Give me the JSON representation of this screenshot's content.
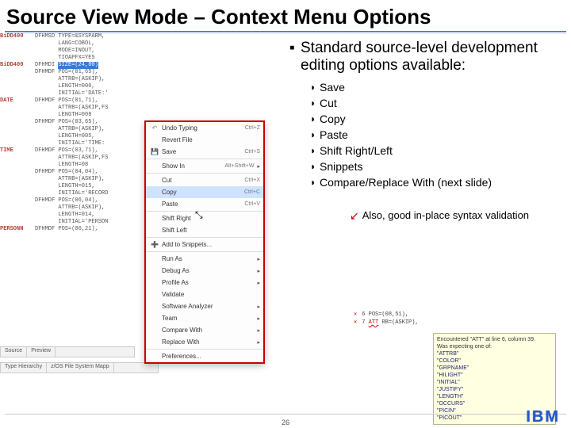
{
  "slide": {
    "title": "Source View Mode – Context Menu Options",
    "page_number": "26",
    "logo_text": "IBM"
  },
  "bullets": {
    "heading": "Standard source-level development  editing options available:",
    "items": [
      "Save",
      "Cut",
      "Copy",
      "Paste",
      "Shift Right/Left",
      "Snippets",
      "Compare/Replace With (next slide)"
    ],
    "note": "Also, good in-place syntax validation"
  },
  "source": {
    "rows": [
      {
        "margin": "BiDD400",
        "code": "DFHMSD TYPE=&SYSPARM,"
      },
      {
        "margin": "",
        "code": "       LANG=COBOL,"
      },
      {
        "margin": "",
        "code": "       MODE=INOUT,"
      },
      {
        "margin": "",
        "code": "       TIOAPFX=YES"
      },
      {
        "margin": "BiDD400",
        "code": "DFHMDI ",
        "hl": "SIZE=(24,80)"
      },
      {
        "margin": "",
        "code": "DFHMDF POS=(01,65),"
      },
      {
        "margin": "",
        "code": "       ATTRB=(ASKIP),"
      },
      {
        "margin": "",
        "code": "       LENGTH=000,"
      },
      {
        "margin": "",
        "code": "       INITIAL='DATE:'"
      },
      {
        "margin": "DATE",
        "code": "DFHMDF POS=(01,71),"
      },
      {
        "margin": "",
        "code": "       ATTRB=(ASKIP,FS"
      },
      {
        "margin": "",
        "code": "       LENGTH=008"
      },
      {
        "margin": "",
        "code": "DFHMDF POS=(03,65),"
      },
      {
        "margin": "",
        "code": "       ATTRB=(ASKIP),"
      },
      {
        "margin": "",
        "code": "       LENGTH=005,"
      },
      {
        "margin": "",
        "code": "       INITIAL='TIME:"
      },
      {
        "margin": "TIME",
        "code": "DFHMDF POS=(03,71),"
      },
      {
        "margin": "",
        "code": "       ATTRB=(ASKIP,FS"
      },
      {
        "margin": "",
        "code": "       LENGTH=08"
      },
      {
        "margin": "",
        "code": "DFHMDF POS=(04,04),"
      },
      {
        "margin": "",
        "code": "       ATTRB=(ASKIP),"
      },
      {
        "margin": "",
        "code": "       LENGTH=015,"
      },
      {
        "margin": "",
        "code": "       INITIAL='RECORD"
      },
      {
        "margin": "",
        "code": "DFHMDF POS=(06,04),"
      },
      {
        "margin": "",
        "code": "       ATTRB=(ASKIP),"
      },
      {
        "margin": "",
        "code": "       LENGTH=014,"
      },
      {
        "margin": "",
        "code": "       INITIAL='PERSON"
      },
      {
        "margin": "PERSONN",
        "code": "DFHMDF POS=(06,21),"
      }
    ],
    "bottom_tabs1": [
      "Source",
      "Preview"
    ],
    "bottom_tabs2": [
      "Type Hierarchy",
      "z/OS File System Mapp"
    ]
  },
  "context_menu": {
    "groups": [
      [
        {
          "icon": "↶",
          "label": "Undo Typing",
          "accel": "Ctrl+Z"
        },
        {
          "icon": "",
          "label": "Revert File",
          "accel": ""
        },
        {
          "icon": "💾",
          "label": "Save",
          "accel": "Ctrl+S"
        }
      ],
      [
        {
          "icon": "",
          "label": "Show In",
          "accel": "Alt+Shift+W",
          "sub": true
        }
      ],
      [
        {
          "icon": "",
          "label": "Cut",
          "accel": "Ctrl+X"
        },
        {
          "icon": "",
          "label": "Copy",
          "accel": "Ctrl+C",
          "hl": true
        },
        {
          "icon": "",
          "label": "Paste",
          "accel": "Ctrl+V"
        }
      ],
      [
        {
          "icon": "",
          "label": "Shift Right",
          "accel": ""
        },
        {
          "icon": "",
          "label": "Shift Left",
          "accel": ""
        }
      ],
      [
        {
          "icon": "➕",
          "label": "Add to Snippets...",
          "accel": ""
        }
      ],
      [
        {
          "icon": "",
          "label": "Run As",
          "accel": "",
          "sub": true
        },
        {
          "icon": "",
          "label": "Debug As",
          "accel": "",
          "sub": true
        },
        {
          "icon": "",
          "label": "Profile As",
          "accel": "",
          "sub": true
        },
        {
          "icon": "",
          "label": "Validate",
          "accel": ""
        },
        {
          "icon": "",
          "label": "Software Analyzer",
          "accel": "",
          "sub": true
        },
        {
          "icon": "",
          "label": "Team",
          "accel": "",
          "sub": true
        },
        {
          "icon": "",
          "label": "Compare With",
          "accel": "",
          "sub": true
        },
        {
          "icon": "",
          "label": "Replace With",
          "accel": "",
          "sub": true
        }
      ],
      [
        {
          "icon": "",
          "label": "Preferences...",
          "accel": ""
        }
      ]
    ]
  },
  "validation": {
    "src_lines": [
      {
        "err": "✕",
        "n": "6",
        "text": "       POS=(08,51),"
      },
      {
        "err": "✕",
        "n": "7",
        "text": "       ATT RB=(ASKIP),",
        "bad": "ATT"
      },
      {
        "err": "",
        "n": "",
        "text": ""
      }
    ],
    "tooltip": {
      "msg": "Encountered \"ATT\" at line 6, column 39.",
      "expect_label": "Was expecting one of:",
      "expect": [
        "\"ATTRB\"",
        "\"COLOR\"",
        "\"GRPNAME\"",
        "\"HILIGHT\"",
        "\"INITIAL\"",
        "\"JUSTIFY\"",
        "\"LENGTH\"",
        "\"OCCURS\"",
        "\"PICIN\"",
        "\"PICOUT\""
      ]
    }
  }
}
